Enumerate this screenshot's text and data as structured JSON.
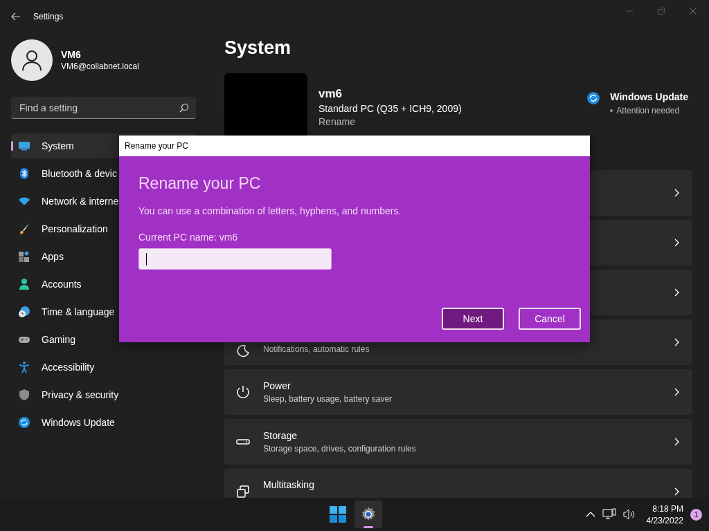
{
  "window": {
    "title": "Settings"
  },
  "profile": {
    "name": "VM6",
    "email": "VM6@collabnet.local"
  },
  "search": {
    "placeholder": "Find a setting"
  },
  "nav": [
    {
      "label": "System",
      "kind": "system",
      "selected": true
    },
    {
      "label": "Bluetooth & devic",
      "kind": "bluetooth",
      "selected": false
    },
    {
      "label": "Network & interne",
      "kind": "network",
      "selected": false
    },
    {
      "label": "Personalization",
      "kind": "brush",
      "selected": false
    },
    {
      "label": "Apps",
      "kind": "apps",
      "selected": false
    },
    {
      "label": "Accounts",
      "kind": "accounts",
      "selected": false
    },
    {
      "label": "Time & language",
      "kind": "time",
      "selected": false
    },
    {
      "label": "Gaming",
      "kind": "gaming",
      "selected": false
    },
    {
      "label": "Accessibility",
      "kind": "accessibility",
      "selected": false
    },
    {
      "label": "Privacy & security",
      "kind": "privacy",
      "selected": false
    },
    {
      "label": "Windows Update",
      "kind": "update",
      "selected": false
    }
  ],
  "page_title": "System",
  "device": {
    "name": "vm6",
    "model": "Standard PC (Q35 + ICH9, 2009)",
    "rename_link": "Rename"
  },
  "update_status": {
    "title": "Windows Update",
    "status": "Attention needed"
  },
  "cards": [
    {
      "kind": "covered"
    },
    {
      "kind": "covered"
    },
    {
      "kind": "covered"
    },
    {
      "kind": "focus",
      "subtitle": "Notifications, automatic rules"
    },
    {
      "kind": "power",
      "title": "Power",
      "subtitle": "Sleep, battery usage, battery saver"
    },
    {
      "kind": "storage",
      "title": "Storage",
      "subtitle": "Storage space, drives, configuration rules"
    },
    {
      "kind": "multitasking",
      "title": "Multitasking"
    }
  ],
  "dialog": {
    "window_title": "Rename your PC",
    "heading": "Rename your PC",
    "description": "You can use a combination of letters, hyphens, and numbers.",
    "current_name": "Current PC name: vm6",
    "buttons": [
      {
        "label": "Next",
        "kind": "primary"
      },
      {
        "label": "Cancel",
        "kind": "secondary"
      }
    ]
  },
  "taskbar": {
    "apps": [
      {
        "kind": "start",
        "selected": false
      },
      {
        "kind": "settings",
        "selected": true
      }
    ],
    "time": "8:18 PM",
    "date": "4/23/2022",
    "notification_count": "1"
  }
}
